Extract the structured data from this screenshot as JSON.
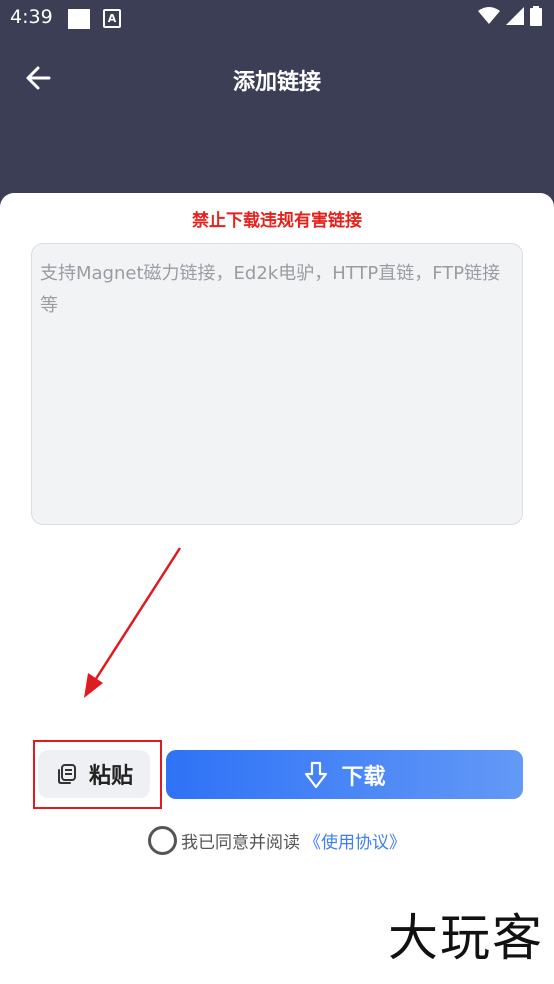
{
  "status_bar": {
    "time": "4:39",
    "notif_icon": "A"
  },
  "header": {
    "title": "添加链接",
    "back_icon": "arrow-left-icon"
  },
  "warning": {
    "text": "禁止下载违规有害链接",
    "color": "#e8201c"
  },
  "link_input": {
    "placeholder": "支持Magnet磁力链接，Ed2k电驴，HTTP直链，FTP链接等",
    "value": ""
  },
  "paste_button": {
    "label": "粘贴",
    "icon": "clipboard-icon"
  },
  "download_button": {
    "label": "下载",
    "icon": "download-arrow-icon"
  },
  "agreement": {
    "text": "我已同意并阅读",
    "link": "《使用协议》",
    "checked": false
  },
  "watermark": {
    "text": "大玩客"
  },
  "colors": {
    "header_bg": "#3b3e54",
    "accent": "#2e72f6",
    "link": "#3f7ef2",
    "annotation": "#e01b20"
  }
}
